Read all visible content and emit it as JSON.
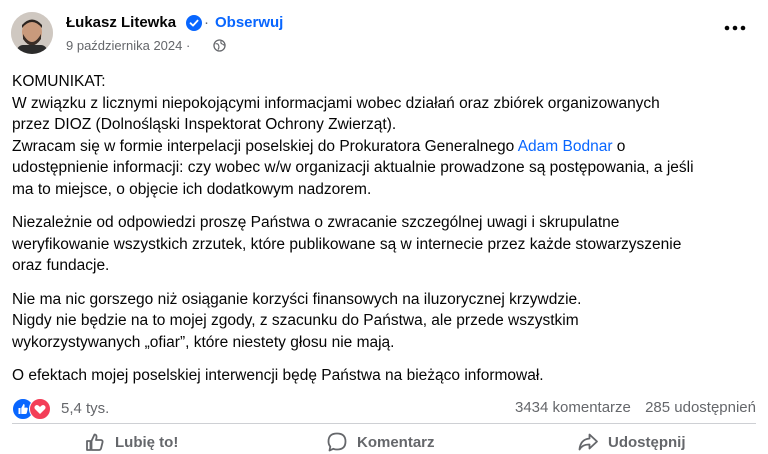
{
  "post": {
    "author": "Łukasz Litewka",
    "follow_label": "Obserwuj",
    "separator": "·",
    "date": "9 października 2024 ·",
    "paragraphs": [
      {
        "lines": [
          "KOMUNIKAT:",
          "W związku z licznymi niepokojącymi informacjami wobec działań oraz zbiórek organizowanych",
          "przez DIOZ (Dolnośląski Inspektorat Ochrony Zwierząt)."
        ],
        "pre_link": "Zwracam się w formie interpelacji poselskiej do Prokuratora Generalnego ",
        "link": "Adam Bodnar",
        "post_link": " o",
        "tail_lines": [
          "udostępnienie informacji: czy wobec w/w organizacji aktualnie prowadzone są postępowania, a jeśli",
          "ma to miejsce, o objęcie ich dodatkowym nadzorem."
        ]
      }
    ],
    "p2": [
      "Niezależnie od odpowiedzi proszę Państwa o zwracanie szczególnej uwagi i skrupulatne",
      "weryfikowanie wszystkich zrzutek, które publikowane są w internecie przez każde stowarzyszenie",
      "oraz fundacje."
    ],
    "p3": [
      "Nie ma nic gorszego niż osiąganie korzyści finansowych na iluzorycznej krzywdzie.",
      "Nigdy nie będzie na to mojej zgody, z szacunku do Państwa, ale przede wszystkim",
      "wykorzystywanych „ofiar”, które niestety głosu nie mają."
    ],
    "p4": "O efektach mojej poselskiej interwencji będę Państwa na bieżąco informował."
  },
  "engagement": {
    "reactions_count": "5,4 tys.",
    "comments": "3434 komentarze",
    "shares": "285 udostępnień"
  },
  "actions": {
    "like": "Lubię to!",
    "comment": "Komentarz",
    "share": "Udostępnij"
  },
  "colors": {
    "accent": "#0866ff",
    "secondary_text": "#65676b",
    "love": "#f33e58"
  },
  "icons": [
    "verified-badge-icon",
    "globe-icon",
    "more-options-icon",
    "like-reaction-icon",
    "love-reaction-icon",
    "thumbs-up-icon",
    "comment-icon",
    "share-icon"
  ]
}
